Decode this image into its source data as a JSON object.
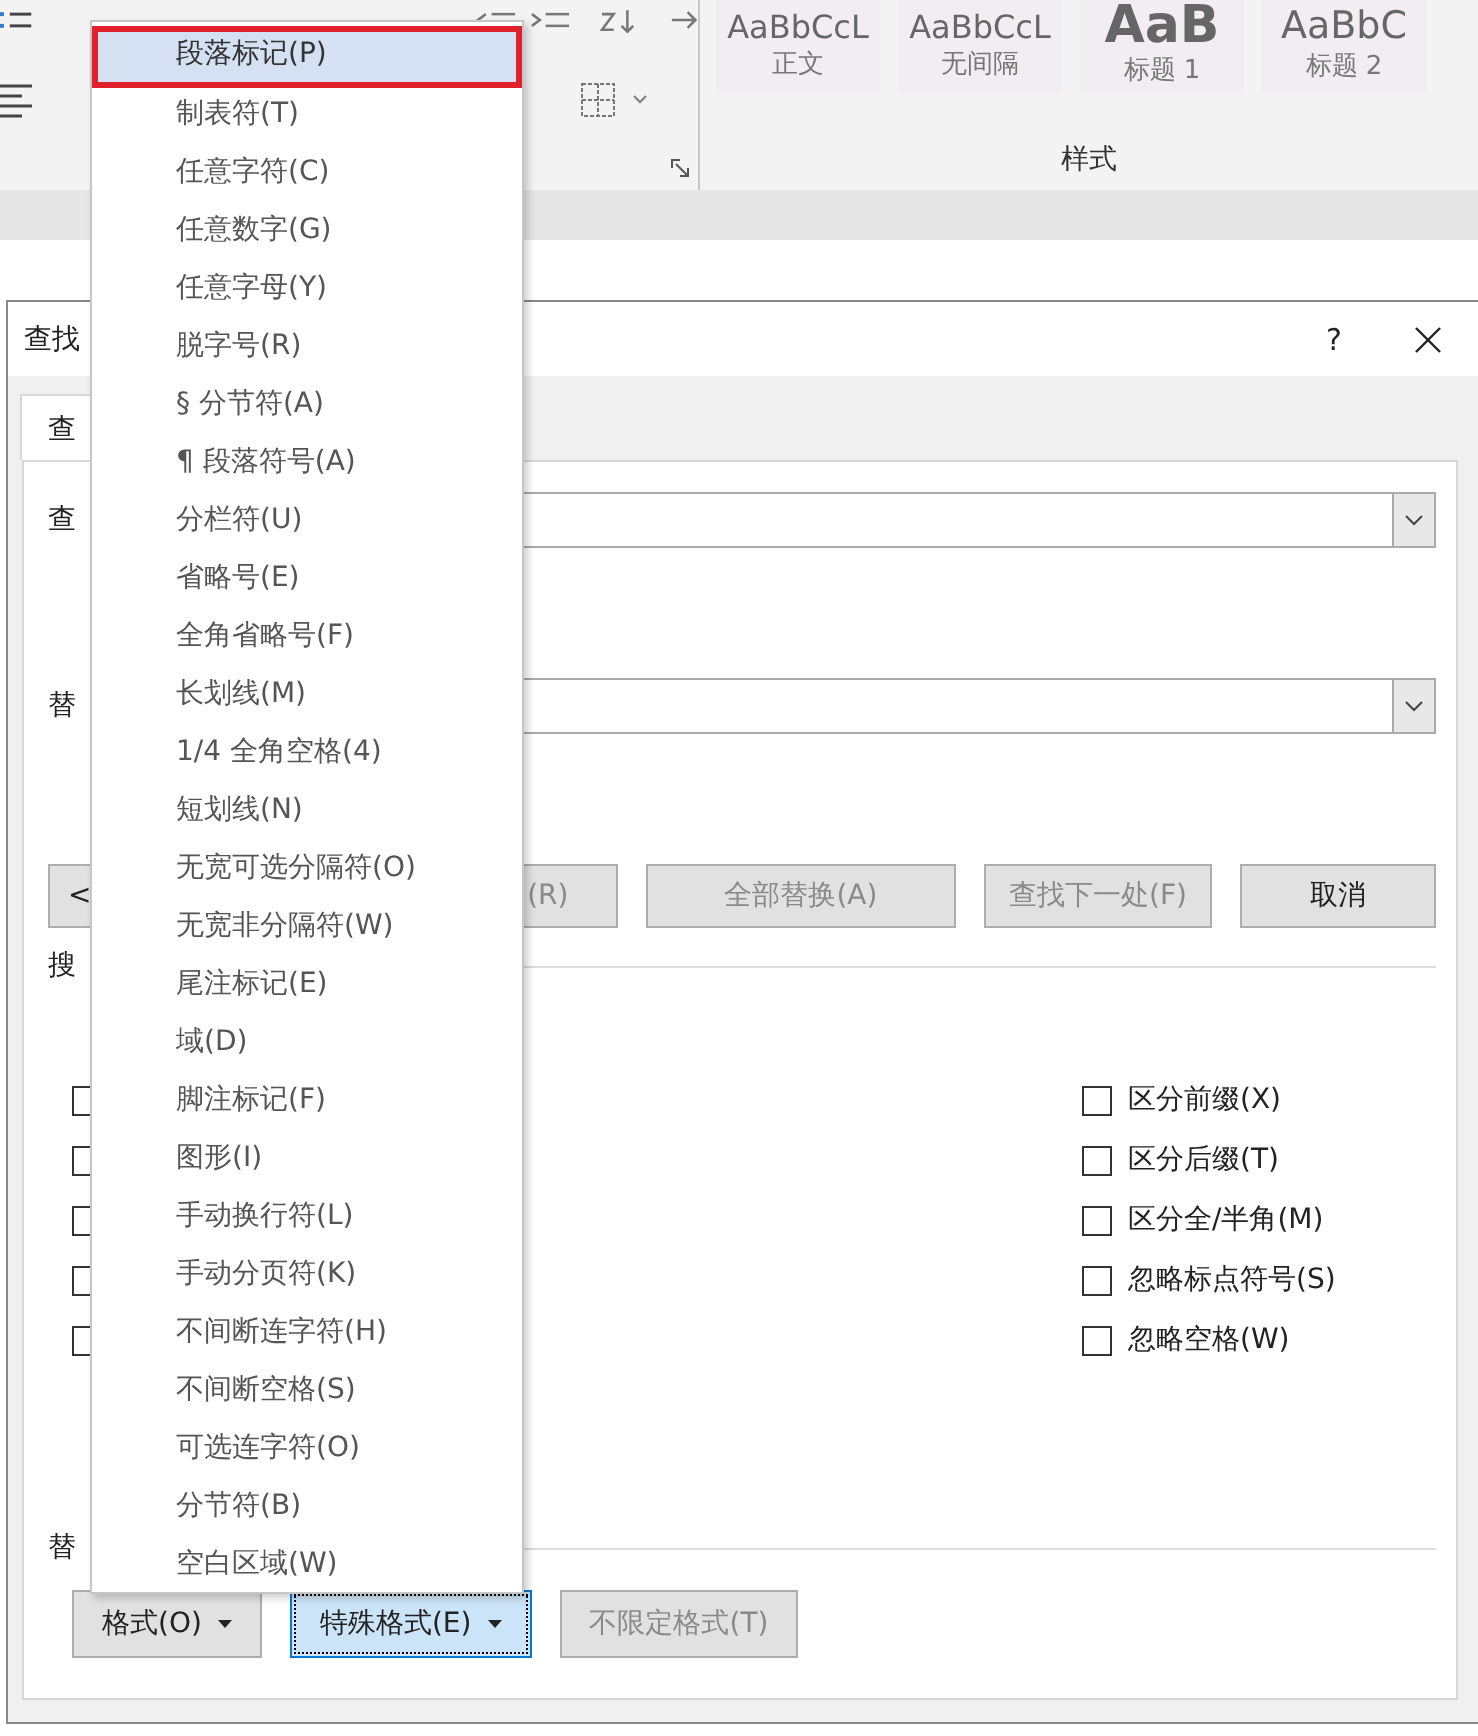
{
  "ribbon": {
    "styles": [
      {
        "sample": "AaBbCcL",
        "name": "正文",
        "kind": "paragraph"
      },
      {
        "sample": "AaBbCcL",
        "name": "无间隔",
        "kind": "paragraph"
      },
      {
        "sample": "AaB",
        "name": "标题 1",
        "kind": "heading"
      },
      {
        "sample": "AaBbC",
        "name": "标题 2",
        "kind": "subheading"
      }
    ],
    "group_label": "样式"
  },
  "dialog": {
    "title": "查找",
    "help": "?",
    "tab": "查",
    "find_label": "查",
    "replace_label": "替",
    "buttons": [
      {
        "label": "<",
        "disabled": false
      },
      {
        "label": "(R)",
        "disabled": true
      },
      {
        "label": "全部替换(A)",
        "disabled": true
      },
      {
        "label": "查找下一处(F)",
        "disabled": true
      },
      {
        "label": "取消",
        "disabled": false
      }
    ],
    "options_heading": "搜",
    "left_options": [
      {
        "checked": false
      },
      {
        "checked": false
      },
      {
        "checked": false
      },
      {
        "checked": false
      },
      {
        "checked": false
      }
    ],
    "right_options": [
      {
        "label": "区分前缀(X)",
        "checked": false
      },
      {
        "label": "区分后缀(T)",
        "checked": false
      },
      {
        "label": "区分全/半角(M)",
        "checked": false
      },
      {
        "label": "忽略标点符号(S)",
        "checked": false
      },
      {
        "label": "忽略空格(W)",
        "checked": false
      }
    ],
    "replace_section_label": "替",
    "bottom_buttons": [
      {
        "label": "格式(O)",
        "dropdown": true,
        "focused": false,
        "disabled": false
      },
      {
        "label": "特殊格式(E)",
        "dropdown": true,
        "focused": true,
        "disabled": false
      },
      {
        "label": "不限定格式(T)",
        "dropdown": false,
        "focused": false,
        "disabled": true
      }
    ]
  },
  "menu": {
    "items": [
      {
        "label": "段落标记(P)",
        "selected": true
      },
      {
        "label": "制表符(T)",
        "selected": false
      },
      {
        "label": "任意字符(C)",
        "selected": false
      },
      {
        "label": "任意数字(G)",
        "selected": false
      },
      {
        "label": "任意字母(Y)",
        "selected": false
      },
      {
        "label": "脱字号(R)",
        "selected": false
      },
      {
        "label": "§ 分节符(A)",
        "selected": false
      },
      {
        "label": "¶ 段落符号(A)",
        "selected": false
      },
      {
        "label": "分栏符(U)",
        "selected": false
      },
      {
        "label": "省略号(E)",
        "selected": false
      },
      {
        "label": "全角省略号(F)",
        "selected": false
      },
      {
        "label": "长划线(M)",
        "selected": false
      },
      {
        "label": "1/4 全角空格(4)",
        "selected": false
      },
      {
        "label": "短划线(N)",
        "selected": false
      },
      {
        "label": "无宽可选分隔符(O)",
        "selected": false
      },
      {
        "label": "无宽非分隔符(W)",
        "selected": false
      },
      {
        "label": "尾注标记(E)",
        "selected": false
      },
      {
        "label": "域(D)",
        "selected": false
      },
      {
        "label": "脚注标记(F)",
        "selected": false
      },
      {
        "label": "图形(I)",
        "selected": false
      },
      {
        "label": "手动换行符(L)",
        "selected": false
      },
      {
        "label": "手动分页符(K)",
        "selected": false
      },
      {
        "label": "不间断连字符(H)",
        "selected": false
      },
      {
        "label": "不间断空格(S)",
        "selected": false
      },
      {
        "label": "可选连字符(O)",
        "selected": false
      },
      {
        "label": "分节符(B)",
        "selected": false
      },
      {
        "label": "空白区域(W)",
        "selected": false
      }
    ]
  }
}
